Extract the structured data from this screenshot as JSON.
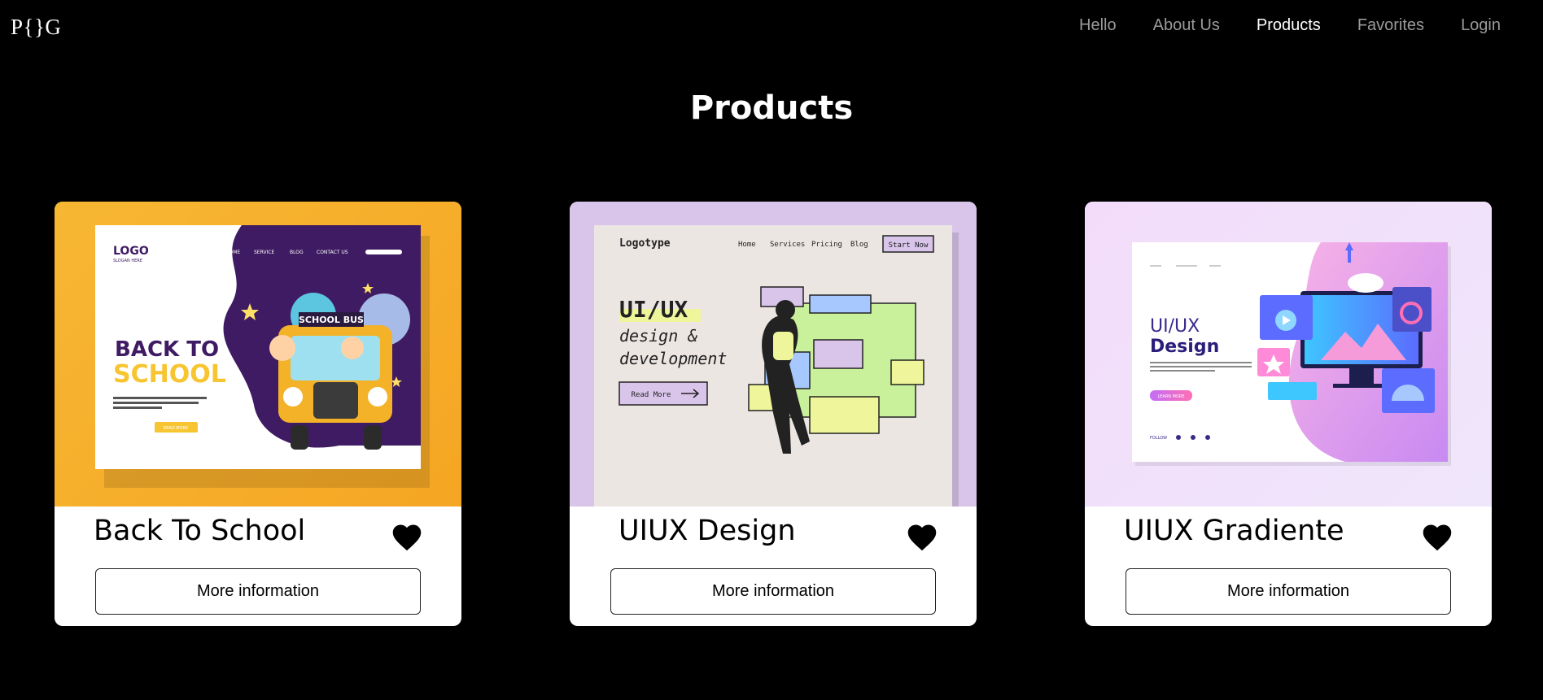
{
  "header": {
    "logo": "P{}G",
    "nav": [
      "Hello",
      "About Us",
      "Products",
      "Favorites",
      "Login"
    ],
    "active_nav": "Products"
  },
  "page": {
    "title": "Products"
  },
  "products": [
    {
      "title": "Back To School",
      "button": "More information",
      "image": {
        "logo": "LOGO",
        "tagline": "SLOGAN HERE",
        "menu": [
          "HOME",
          "SERVICE",
          "BLOG",
          "CONTACT US"
        ],
        "headline_1": "BACK TO",
        "headline_2": "SCHOOL",
        "bus_sign": "SCHOOL BUS",
        "cta": "READ MORE"
      }
    },
    {
      "title": "UIUX Design",
      "button": "More information",
      "image": {
        "logo": "Logotype",
        "menu": [
          "Home",
          "Services",
          "Pricing",
          "Blog"
        ],
        "cta_top": "Start Now",
        "headline": "UI/UX",
        "sub_1": "design &",
        "sub_2": "development",
        "cta": "Read More"
      }
    },
    {
      "title": "UIUX Gradiente",
      "button": "More information",
      "image": {
        "headline_1": "UI/UX",
        "headline_2": "Design",
        "cta": "LEARN MORE",
        "follow": "FOLLOW"
      }
    }
  ],
  "colors": {
    "background": "#000000",
    "nav_inactive": "#9a9a9a",
    "accent_yellow": "#f5a623",
    "accent_purple": "#4a1d6e"
  }
}
